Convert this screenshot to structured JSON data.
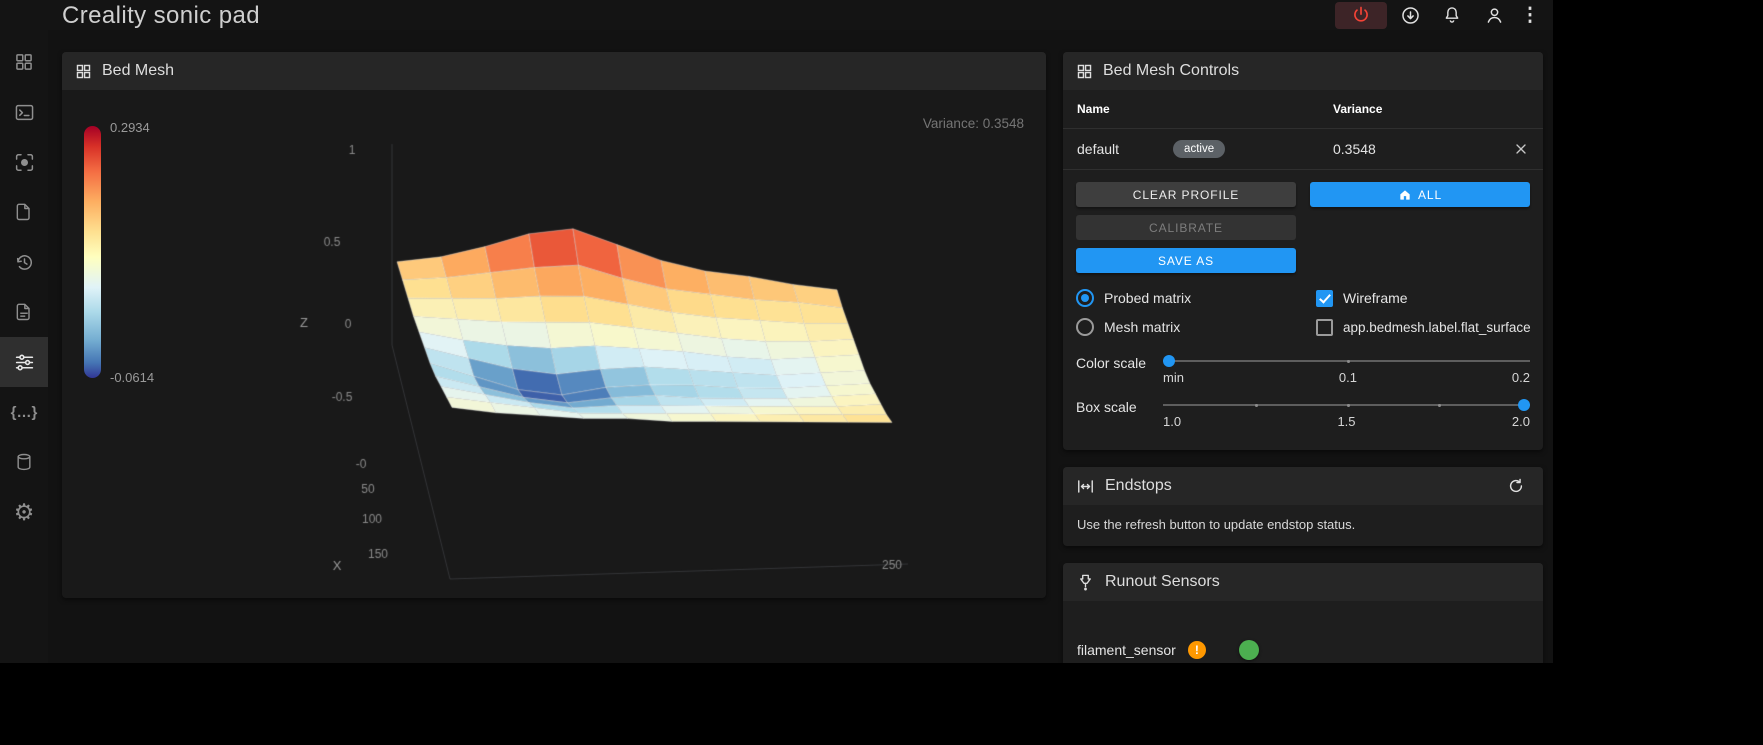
{
  "topbar": {
    "title": "Creality sonic pad"
  },
  "icons": {
    "macros_glyph": "{…}",
    "gear_glyph": "⚙",
    "kebab_glyph": "⋮",
    "warning_glyph": "!"
  },
  "bed_mesh": {
    "title": "Bed Mesh",
    "variance_label": "Variance: 0.3548",
    "colorbar_max": "0.2934",
    "colorbar_min": "-0.0614"
  },
  "chart_data": {
    "type": "surface",
    "title": "Bed Mesh",
    "variance": 0.3548,
    "z_range": [
      -0.0614,
      0.2934
    ],
    "z_axis_ticks": [
      "1",
      "0.5",
      "0",
      "-0.5"
    ],
    "y_axis_ticks": [
      "-0",
      "50",
      "100",
      "150"
    ],
    "x_axis_ticks": [
      "250"
    ],
    "x_label": "X",
    "z_label": "Z",
    "matrix": [
      [
        0.12,
        0.15,
        0.2,
        0.26,
        0.29,
        0.24,
        0.19,
        0.16,
        0.15,
        0.13,
        0.12
      ],
      [
        0.1,
        0.12,
        0.15,
        0.18,
        0.2,
        0.16,
        0.13,
        0.12,
        0.11,
        0.11,
        0.1
      ],
      [
        0.08,
        0.09,
        0.1,
        0.12,
        0.13,
        0.11,
        0.09,
        0.08,
        0.08,
        0.08,
        0.09
      ],
      [
        0.06,
        0.06,
        0.06,
        0.07,
        0.08,
        0.07,
        0.06,
        0.05,
        0.05,
        0.06,
        0.08
      ],
      [
        0.05,
        0.03,
        0.02,
        0.02,
        0.04,
        0.04,
        0.04,
        0.03,
        0.03,
        0.05,
        0.07
      ],
      [
        0.04,
        0.01,
        -0.02,
        -0.03,
        0.0,
        0.02,
        0.02,
        0.02,
        0.02,
        0.04,
        0.06
      ],
      [
        0.03,
        -0.01,
        -0.05,
        -0.06,
        -0.02,
        0.0,
        0.01,
        0.01,
        0.02,
        0.04,
        0.06
      ],
      [
        0.03,
        0.0,
        -0.03,
        -0.04,
        -0.01,
        0.01,
        0.01,
        0.02,
        0.03,
        0.05,
        0.07
      ],
      [
        0.04,
        0.02,
        0.0,
        -0.01,
        0.01,
        0.02,
        0.03,
        0.04,
        0.05,
        0.06,
        0.08
      ],
      [
        0.05,
        0.04,
        0.03,
        0.02,
        0.03,
        0.04,
        0.05,
        0.06,
        0.07,
        0.08,
        0.09
      ],
      [
        0.06,
        0.05,
        0.05,
        0.05,
        0.06,
        0.06,
        0.07,
        0.08,
        0.09,
        0.1,
        0.11
      ]
    ]
  },
  "controls": {
    "title": "Bed Mesh Controls",
    "col_name": "Name",
    "col_variance": "Variance",
    "profile": {
      "name": "default",
      "badge": "active",
      "variance": "0.3548"
    },
    "buttons": {
      "clear": "CLEAR PROFILE",
      "all": "ALL",
      "calibrate": "CALIBRATE",
      "save_as": "SAVE AS"
    },
    "options": {
      "probed": "Probed matrix",
      "mesh": "Mesh matrix",
      "wireframe": "Wireframe",
      "flat": "app.bedmesh.label.flat_surface"
    },
    "color_scale": {
      "label": "Color scale",
      "t0": "min",
      "t1": "0.1",
      "t2": "0.2"
    },
    "box_scale": {
      "label": "Box scale",
      "t0": "1.0",
      "t1": "1.5",
      "t2": "2.0"
    }
  },
  "endstops": {
    "title": "Endstops",
    "message": "Use the refresh button to update endstop status."
  },
  "runout": {
    "title": "Runout Sensors",
    "sensor": "filament_sensor"
  },
  "colors": {
    "accent": "#2196f3",
    "estop_red": "#f44336",
    "warning": "#ff9800",
    "toggle_green": "#4caf50"
  }
}
